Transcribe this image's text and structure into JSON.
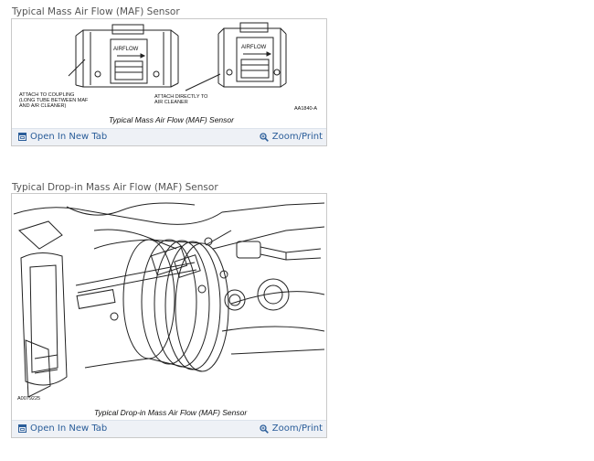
{
  "sections": [
    {
      "title": "Typical Mass Air Flow (MAF) Sensor",
      "figure": {
        "labels": {
          "airflow_left": "AIRFLOW",
          "airflow_right": "AIRFLOW",
          "callout_left": [
            "ATTACH TO COUPLING",
            "(LONG TUBE BETWEEN MAF",
            "AND A/R CLEANER)"
          ],
          "callout_right": [
            "ATTACH DIRECTLY TO",
            "AIR CLEANER"
          ],
          "figure_id": "AA1840-A",
          "caption": "Typical Mass Air Flow (MAF) Sensor"
        }
      },
      "open_label": "Open In New Tab",
      "zoom_label": "Zoom/Print"
    },
    {
      "title": "Typical Drop-in Mass Air Flow (MAF) Sensor",
      "figure": {
        "labels": {
          "figure_id": "A0079225",
          "caption": "Typical Drop-in Mass Air Flow (MAF) Sensor"
        }
      },
      "open_label": "Open In New Tab",
      "zoom_label": "Zoom/Print"
    }
  ],
  "icons": {
    "open": "open-new-tab-icon",
    "zoom": "magnifier-icon"
  },
  "colors": {
    "link": "#2a5d99",
    "footer_bg": "#eef1f6",
    "border": "#c9c9c9"
  }
}
